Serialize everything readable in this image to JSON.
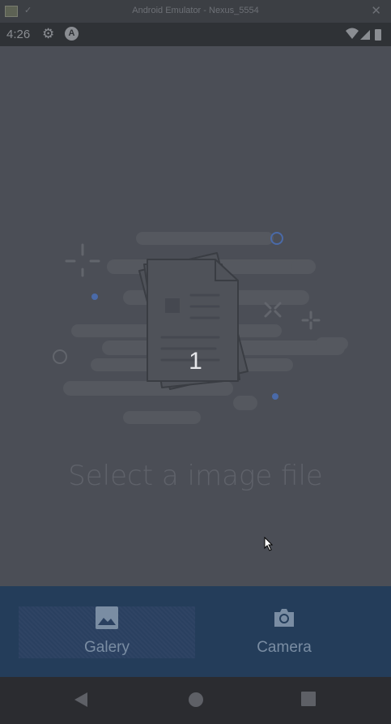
{
  "window": {
    "title": "Android Emulator - Nexus_5554",
    "close_glyph": "✕"
  },
  "status_bar": {
    "time": "4:26",
    "notification_letter": "A"
  },
  "main": {
    "page_number": "1",
    "prompt": "Select a image file"
  },
  "bottom_nav": {
    "items": [
      {
        "label": "Galery",
        "icon": "image-icon",
        "active": true
      },
      {
        "label": "Camera",
        "icon": "camera-icon",
        "active": false
      }
    ]
  },
  "system_nav": {
    "buttons": [
      "back-icon",
      "home-icon",
      "recents-icon"
    ]
  },
  "colors": {
    "accent": "#243d5a",
    "overlay_bg": "#4b4e56",
    "illustration_dot": "#4a6aa8"
  }
}
